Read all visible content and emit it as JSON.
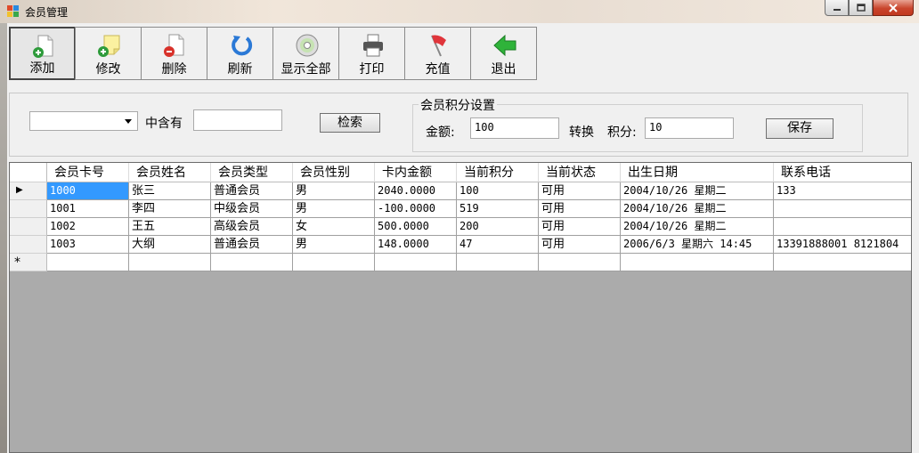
{
  "window": {
    "title": "会员管理"
  },
  "toolbar": {
    "buttons": [
      {
        "label": "添加",
        "icon": "add-document-icon"
      },
      {
        "label": "修改",
        "icon": "edit-note-icon"
      },
      {
        "label": "删除",
        "icon": "delete-document-icon"
      },
      {
        "label": "刷新",
        "icon": "refresh-icon"
      },
      {
        "label": "显示全部",
        "icon": "disc-icon"
      },
      {
        "label": "打印",
        "icon": "printer-icon"
      },
      {
        "label": "充值",
        "icon": "flag-icon"
      },
      {
        "label": "退出",
        "icon": "exit-arrow-icon"
      }
    ]
  },
  "search": {
    "field_value": "",
    "contains_label": "中含有",
    "keyword_value": "",
    "search_button": "检索"
  },
  "points": {
    "group_title": "会员积分设置",
    "amount_label": "金额:",
    "amount_value": "100",
    "convert_label": "转换",
    "points_label": "积分:",
    "points_value": "10",
    "save_button": "保存"
  },
  "grid": {
    "columns": [
      "会员卡号",
      "会员姓名",
      "会员类型",
      "会员性别",
      "卡内金额",
      "当前积分",
      "当前状态",
      "出生日期",
      "联系电话"
    ],
    "rows": [
      [
        "1000",
        "张三",
        "普通会员",
        "男",
        "2040.0000",
        "100",
        "可用",
        "2004/10/26 星期二",
        "133"
      ],
      [
        "1001",
        "李四",
        "中级会员",
        "男",
        "-100.0000",
        "519",
        "可用",
        "2004/10/26 星期二",
        ""
      ],
      [
        "1002",
        "王五",
        "高级会员",
        "女",
        "500.0000",
        "200",
        "可用",
        "2004/10/26 星期二",
        ""
      ],
      [
        "1003",
        "大纲",
        "普通会员",
        "男",
        "148.0000",
        "47",
        "可用",
        "2006/6/3 星期六 14:45",
        "13391888001 8121804"
      ]
    ],
    "current_row_marker": "▶",
    "new_row_marker": "*"
  }
}
